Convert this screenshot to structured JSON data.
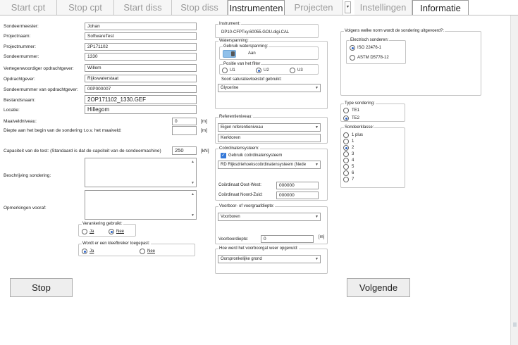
{
  "tabs": {
    "start_cpt": "Start cpt",
    "stop_cpt": "Stop cpt",
    "start_diss": "Start diss",
    "stop_diss": "Stop diss",
    "instrumenten": "Instrumenten",
    "projecten": "Projecten",
    "dropdown": "▾",
    "instellingen": "Instellingen",
    "informatie": "Informatie"
  },
  "form": {
    "sondeermeester_label": "Sondeermeester:",
    "sondeermeester": "Johan",
    "projectnaam_label": "Projectnaam:",
    "projectnaam": "SoftwareTest",
    "projectnummer_label": "Projectnummer:",
    "projectnummer": "2P171102",
    "sondeernummer_label": "Sondeernummer:",
    "sondeernummer": "1330",
    "vertegenwoordiger_label": "Vertegenwoordiger opdrachtgever:",
    "vertegenwoordiger": "Willem",
    "opdrachtgever_label": "Opdrachtgever:",
    "opdrachtgever": "Rijkswaterstaat",
    "sondeernummer_og_label": "Sondeernummer van opdrachtgever:",
    "sondeernummer_og": "00P000007",
    "bestandsnaam_label": "Bestandsnaam:",
    "bestandsnaam": "2OP171102_1330.GEF",
    "locatie_label": "Locatie:",
    "locatie": "Hillegom",
    "maaiveld_label": "Maaiveldniveau:",
    "maaiveld": "0",
    "maaiveld_unit": "[m]",
    "diepte_label": "Diepte aan het begin van de sondering t.o.v. het maaiveld:",
    "diepte": "",
    "diepte_unit": "[m]",
    "capaciteit_label": "Capaciteit van de test:  (Standaard is dat de capciteit van de sondeermachine)",
    "capaciteit": "250",
    "capaciteit_unit": "[kN]",
    "beschrijving_label": "Beschrijving sondering:",
    "opmerkingen_label": "Opmerkingen vooraf:",
    "verankering_title": "Verankering gebruikt:",
    "verankering_ja": "Ja",
    "verankering_nee": "Nee",
    "kleefbreker_title": "Wordt er een kleefbreker toegepast:",
    "kleefbreker_ja": "Ja",
    "kleefbreker_nee": "Nee"
  },
  "middle": {
    "instrument_title": "Instrument:",
    "instrument_value": "DP10-CFPTxy.60055.GOU.digi.CAL",
    "waterspanning_title": "Waterspanning:",
    "gebruik_title": "Gebruik waterspanning:",
    "gebruik_value": "Aan",
    "filter_title": "Positie van het filter",
    "filter_u1": "U1",
    "filter_u2": "U2",
    "filter_u3": "U3",
    "vloeistof_title": "Soort saturatievloeistof gebruikt:",
    "vloeistof_value": "Glycerine",
    "referentie_title": "Referentieniveau:",
    "referentie_value": "Eigen referentieniveau",
    "referentie_text": "Kerktoren",
    "coord_title": "Coördinatensysteem:",
    "coord_checkbox": "Gebruik coördinatensysteem",
    "coord_value": "RD Rijksdriehoekscoördinatensysteem (Nede",
    "oostwest_label": "Coördinaat Oost-West:",
    "oostwest_value": "000000",
    "noordzuid_label": "Coördinaat Noord-Zuid:",
    "noordzuid_value": "000000",
    "voorboor_title": "Voorboor- of voorgraafdiepte:",
    "voorboor_value": "Voorboren",
    "voorboordiepte_label": "Voorboordiepte:",
    "voorboordiepte_value": "0",
    "voorboordiepte_unit": "[m]",
    "opgevuld_title": "Hoe werd het voorboorgat weer opgevuld:",
    "opgevuld_value": "Oorspronkelijke grond"
  },
  "right": {
    "norm_title": "Volgens welke norm wordt de sondering uitgevoerd?:",
    "electrisch_title": "Electrisch sonderen:",
    "iso": "ISO 22476-1",
    "astm": "ASTM D5778-12",
    "type_title": "Type sondering:",
    "te1": "TE1",
    "te2": "TE2",
    "klasse_title": "Sondeerklasse:",
    "klasse": [
      "1 plus",
      "1",
      "2",
      "3",
      "4",
      "5",
      "6",
      "7"
    ]
  },
  "buttons": {
    "stop": "Stop",
    "volgende": "Volgende"
  }
}
